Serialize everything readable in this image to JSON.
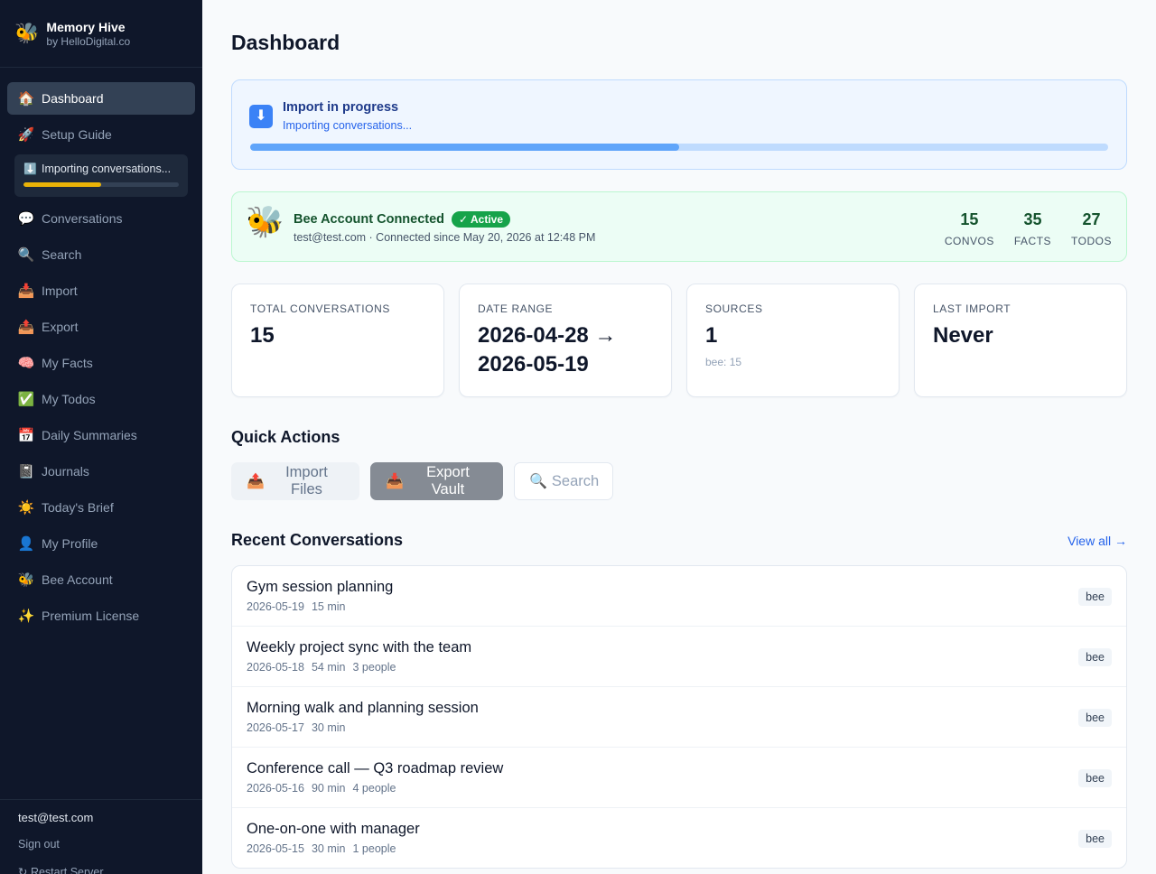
{
  "brand": {
    "logo": "🐝",
    "name": "Memory Hive",
    "sub": "by HelloDigital.co"
  },
  "nav": [
    {
      "icon": "🏠",
      "label": "Dashboard",
      "active": true
    },
    {
      "icon": "🚀",
      "label": "Setup Guide"
    },
    {
      "icon": "💬",
      "label": "Conversations"
    },
    {
      "icon": "🔍",
      "label": "Search"
    },
    {
      "icon": "📥",
      "label": "Import"
    },
    {
      "icon": "📤",
      "label": "Export"
    },
    {
      "icon": "🧠",
      "label": "My Facts"
    },
    {
      "icon": "✅",
      "label": "My Todos"
    },
    {
      "icon": "📅",
      "label": "Daily Summaries"
    },
    {
      "icon": "📓",
      "label": "Journals"
    },
    {
      "icon": "☀️",
      "label": "Today's Brief"
    },
    {
      "icon": "👤",
      "label": "My Profile"
    },
    {
      "icon": "🐝",
      "label": "Bee Account"
    },
    {
      "icon": "✨",
      "label": "Premium License"
    }
  ],
  "sidebar_import": {
    "icon": "⬇️",
    "label": "Importing conversations...",
    "progress": 0.5
  },
  "sidebar_footer": {
    "email": "test@test.com",
    "sign_out": "Sign out",
    "restart": "↻ Restart Server"
  },
  "page": {
    "title": "Dashboard"
  },
  "import_progress": {
    "icon": "⬇",
    "title": "Import in progress",
    "subtitle": "Importing conversations...",
    "progress": 0.5
  },
  "bee_account": {
    "logo": "🐝",
    "title": "Bee Account Connected",
    "badge": "✓ Active",
    "subtitle": "test@test.com · Connected since May 20, 2026 at 12:48 PM",
    "stats": [
      {
        "value": "15",
        "label": "CONVOS"
      },
      {
        "value": "35",
        "label": "FACTS"
      },
      {
        "value": "27",
        "label": "TODOS"
      }
    ]
  },
  "stats": [
    {
      "label": "TOTAL CONVERSATIONS",
      "value": "15",
      "sub": ""
    },
    {
      "label": "DATE RANGE",
      "value": "2026-04-28 → 2026-05-19",
      "sub": ""
    },
    {
      "label": "SOURCES",
      "value": "1",
      "sub": "bee: 15"
    },
    {
      "label": "LAST IMPORT",
      "value": "Never",
      "sub": ""
    }
  ],
  "quick_actions": {
    "title": "Quick Actions",
    "buttons": [
      {
        "icon": "📤",
        "label": "Import Files"
      },
      {
        "icon": "📥",
        "label": "Export Vault"
      },
      {
        "icon": "🔍",
        "label": "Search"
      }
    ]
  },
  "recent": {
    "title": "Recent Conversations",
    "view_all": "View all →",
    "items": [
      {
        "title": "Gym session planning",
        "date": "2026-05-19",
        "duration": "15 min",
        "people": "",
        "source": "bee"
      },
      {
        "title": "Weekly project sync with the team",
        "date": "2026-05-18",
        "duration": "54 min",
        "people": "3 people",
        "source": "bee"
      },
      {
        "title": "Morning walk and planning session",
        "date": "2026-05-17",
        "duration": "30 min",
        "people": "",
        "source": "bee"
      },
      {
        "title": "Conference call — Q3 roadmap review",
        "date": "2026-05-16",
        "duration": "90 min",
        "people": "4 people",
        "source": "bee"
      },
      {
        "title": "One-on-one with manager",
        "date": "2026-05-15",
        "duration": "30 min",
        "people": "1 people",
        "source": "bee"
      }
    ]
  }
}
